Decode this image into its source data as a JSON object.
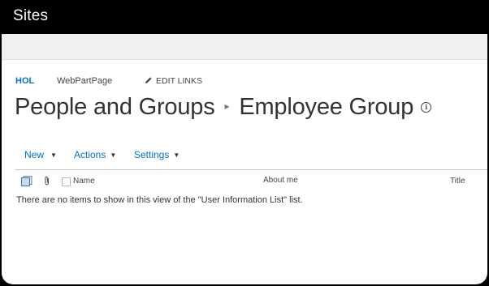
{
  "suite_bar": {
    "title": "Sites"
  },
  "breadcrumb_nav": {
    "home": "HOL",
    "page": "WebPartPage",
    "edit_links": "EDIT LINKS"
  },
  "page_title": {
    "parent": "People and Groups",
    "separator": "▸",
    "current": "Employee Group",
    "info_glyph": "i"
  },
  "toolbar": {
    "new_label": "New",
    "actions_label": "Actions",
    "settings_label": "Settings",
    "caret": "▼"
  },
  "list_headers": {
    "icons": [
      "document-type-icon",
      "attachment-icon",
      "select-all-checkbox"
    ],
    "name": "Name",
    "about_me": "About me",
    "title": "Title"
  },
  "empty_message": "There are no items to show in this view of the \"User Information List\" list.",
  "colors": {
    "suite_bar": "#000000",
    "accent": "#0072c6",
    "ribbon": "#f0f0f0",
    "text": "#333333"
  }
}
